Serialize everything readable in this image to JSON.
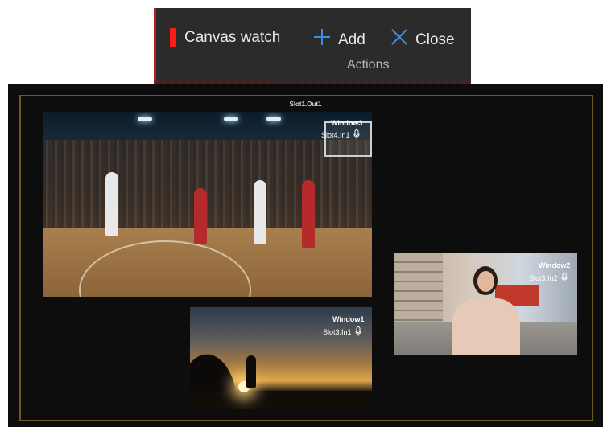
{
  "toolbar": {
    "canvas_watch_label": "Canvas watch",
    "add_label": "Add",
    "close_label": "Close",
    "group_label": "Actions",
    "marker_color": "#ff1a1a",
    "icon_color": "#3d8fe0"
  },
  "canvas": {
    "output_label": "Slot1.Out1",
    "border_color": "#6f5a24",
    "windows": [
      {
        "title": "Window3",
        "source": "Slot4.In1",
        "content": "basketball game"
      },
      {
        "title": "Window1",
        "source": "Slot3.In1",
        "content": "sunset silhouette"
      },
      {
        "title": "Window2",
        "source": "Slot3.In2",
        "content": "street reporter"
      }
    ]
  }
}
